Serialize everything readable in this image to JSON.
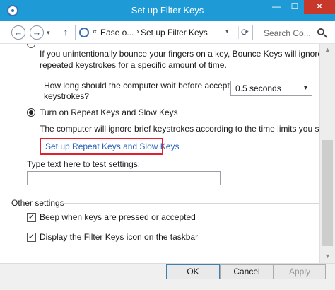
{
  "window": {
    "title": "Set up Filter Keys",
    "minimize_glyph": "—",
    "maximize_glyph": "☐",
    "close_glyph": "✕"
  },
  "nav": {
    "back_glyph": "←",
    "forward_glyph": "→",
    "history_glyph": "▾",
    "up_glyph": "↑",
    "address_overflow": "«",
    "breadcrumbs": [
      "Ease o...",
      "Set up Filter Keys"
    ],
    "breadcrumb_separator": "›",
    "address_dropdown_glyph": "▾",
    "refresh_glyph": "⟳",
    "search_placeholder": "Search Co..."
  },
  "bounce_keys": {
    "description": "If you unintentionally bounce your fingers on a key, Bounce Keys will ignore",
    "description2": "repeated keystrokes for a specific amount of time.",
    "wait_question_line1": "How long should the computer wait before accepting",
    "wait_question_line2": "keystrokes?",
    "wait_value": "0.5 seconds",
    "dropdown_glyph": "▾"
  },
  "repeat_keys": {
    "option_label": "Turn on Repeat Keys and Slow Keys",
    "selected": true,
    "description": "The computer will ignore brief keystrokes according to the time limits you set.",
    "link_label": "Set up Repeat Keys and Slow Keys"
  },
  "test": {
    "label": "Type text here to test settings:",
    "value": ""
  },
  "other_settings": {
    "heading": "Other settings",
    "checkboxes": [
      {
        "label": "Beep when keys are pressed or accepted",
        "checked": true,
        "glyph": "✓"
      },
      {
        "label": "Display the Filter Keys icon on the taskbar",
        "checked": true,
        "glyph": "✓"
      }
    ]
  },
  "scrollbar": {
    "up_glyph": "▲",
    "down_glyph": "▼"
  },
  "buttons": {
    "ok": "OK",
    "cancel": "Cancel",
    "apply": "Apply"
  },
  "colors": {
    "titlebar": "#1e9bd7",
    "close_button": "#c7382b",
    "link": "#2a63b8",
    "highlight_border": "#e0202e"
  }
}
